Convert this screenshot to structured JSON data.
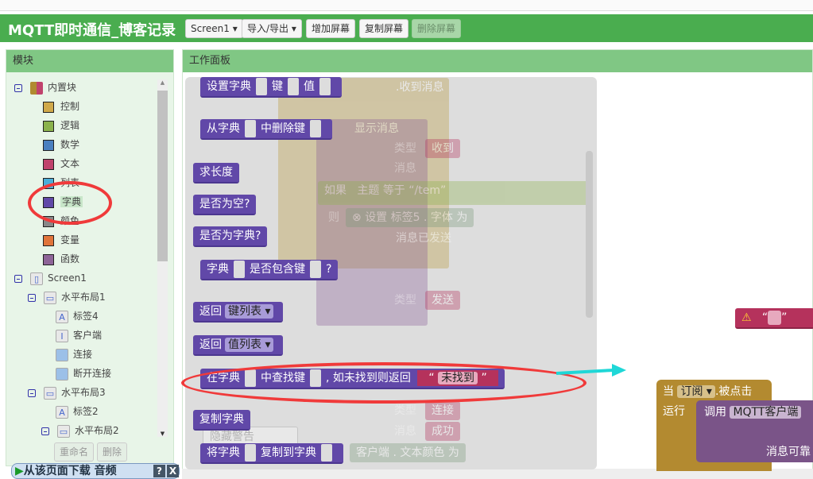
{
  "app": {
    "title": "MQTT即时通信_博客记录"
  },
  "toolbar": {
    "screen": "Screen1",
    "import_export": "导入/导出",
    "add_screen": "增加屏幕",
    "copy_screen": "复制屏幕",
    "delete_screen": "删除屏幕"
  },
  "sidebar": {
    "header": "模块",
    "builtin": "内置块",
    "categories": [
      {
        "label": "控制",
        "color": "#d0a94a"
      },
      {
        "label": "逻辑",
        "color": "#8bb24c"
      },
      {
        "label": "数学",
        "color": "#4a7fc0"
      },
      {
        "label": "文本",
        "color": "#c0426c"
      },
      {
        "label": "列表",
        "color": "#4aaed8"
      },
      {
        "label": "字典",
        "color": "#6148a8"
      },
      {
        "label": "颜色",
        "color": "#888888"
      },
      {
        "label": "变量",
        "color": "#e0743a"
      },
      {
        "label": "函数",
        "color": "#8e6498"
      }
    ],
    "components": [
      {
        "label": "Screen1",
        "icon": "screen-icon"
      },
      {
        "label": "水平布局1",
        "icon": "horizontal-arrangement-icon"
      },
      {
        "label": "标签4",
        "icon": "label-icon"
      },
      {
        "label": "客户端",
        "icon": "textbox-icon"
      },
      {
        "label": "连接",
        "icon": "button-icon"
      },
      {
        "label": "断开连接",
        "icon": "button-icon"
      },
      {
        "label": "水平布局3",
        "icon": "horizontal-arrangement-icon"
      },
      {
        "label": "标签2",
        "icon": "label-icon"
      },
      {
        "label": "水平布局2",
        "icon": "horizontal-arrangement-icon"
      }
    ],
    "rename": "重命名",
    "delete": "删除"
  },
  "download_bar": {
    "label": "从该页面下载 音频",
    "help": "?",
    "close": "X"
  },
  "workspace": {
    "header": "工作面板",
    "flyout": [
      {
        "parts": [
          "设置字典",
          "键",
          "值"
        ]
      },
      {
        "parts": [
          "从字典",
          "中删除键"
        ]
      },
      {
        "parts": [
          "求长度"
        ]
      },
      {
        "parts": [
          "是否为空?"
        ]
      },
      {
        "parts": [
          "是否为字典?"
        ]
      },
      {
        "parts": [
          "字典",
          "是否包含键",
          "?"
        ]
      },
      {
        "parts": [
          "返回",
          "键列表"
        ]
      },
      {
        "parts": [
          "返回",
          "值列表"
        ]
      },
      {
        "parts": [
          "在字典",
          "中查找键",
          ", 如未找到则返回",
          "未找到"
        ]
      },
      {
        "parts": [
          "复制字典"
        ]
      },
      {
        "parts": [
          "将字典",
          "复制到字典"
        ]
      }
    ],
    "background": {
      "received": ".收到消息",
      "topic": "主题",
      "message": "消息",
      "show_msg": "显示消息",
      "type": "类型",
      "recv": "收到",
      "if": "如果",
      "equals": "等于",
      "tem": "/tem",
      "then": "则",
      "set": "设置",
      "label5": "标签5",
      "font": "字体",
      "as": "为",
      "msg_sent": "消息已发送",
      "send": "发送",
      "connect": "连接",
      "success": "成功",
      "hide_warn": "隐藏警告",
      "client": "客户端",
      "text_color": "文本颜色"
    },
    "event": {
      "when": "当",
      "component": "订阅",
      "clicked": ".被点击",
      "do": "运行",
      "call": "调用",
      "mqtt": "MQTT客户端",
      "reliable": "消息可靠"
    }
  }
}
